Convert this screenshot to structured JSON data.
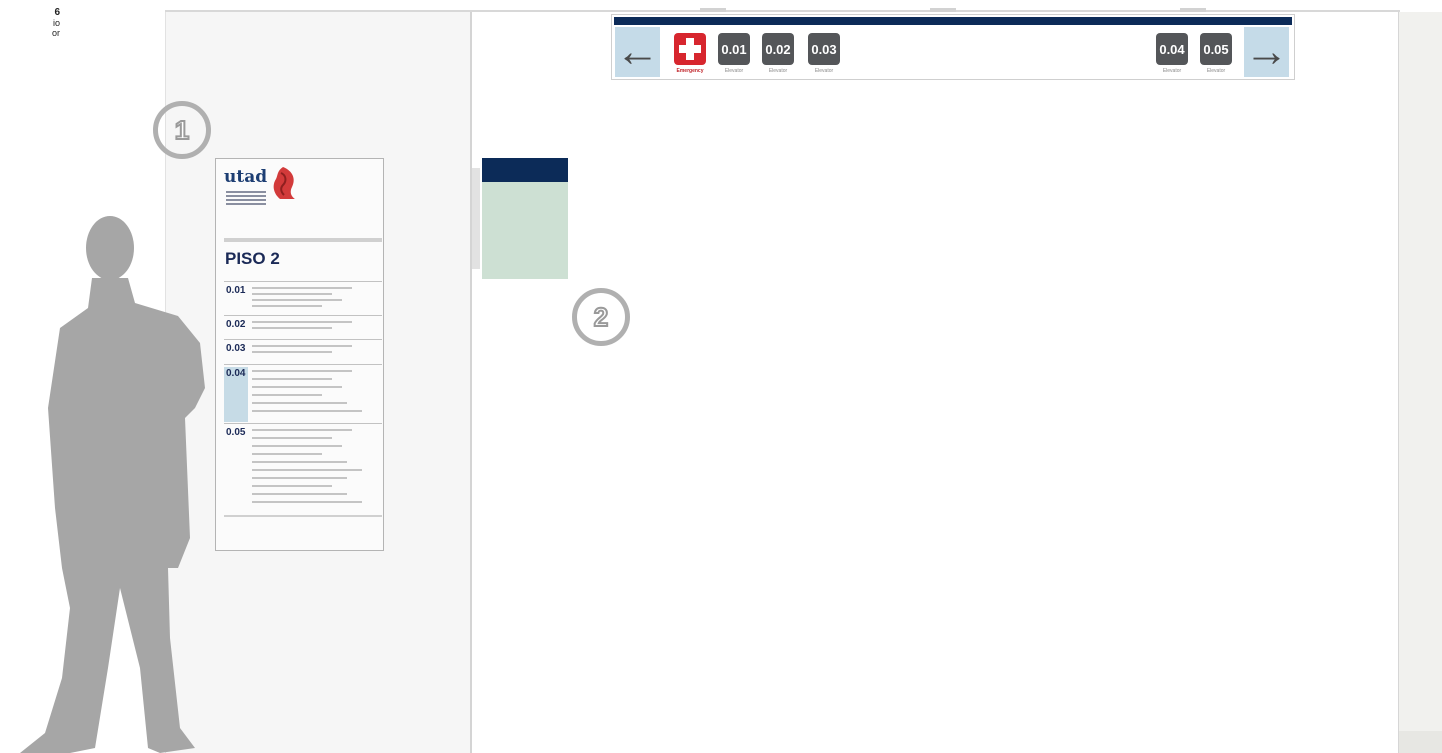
{
  "corner_text": {
    "line1": "6",
    "line2": "io",
    "line3": "or"
  },
  "badges": {
    "one": "1",
    "two": "2"
  },
  "panel": {
    "logo": "utad",
    "floor_title": "PISO 2",
    "rows": [
      {
        "number": "0.01",
        "highlighted": false
      },
      {
        "number": "0.02",
        "highlighted": false
      },
      {
        "number": "0.03",
        "highlighted": false
      },
      {
        "number": "0.04",
        "highlighted": true
      },
      {
        "number": "0.05",
        "highlighted": false
      }
    ]
  },
  "sign_bar": {
    "left_arrow": "←",
    "right_arrow": "→",
    "emergency_label": "Emergency",
    "rooms": [
      {
        "label": "0.01",
        "sub": "Elevator"
      },
      {
        "label": "0.02",
        "sub": "Elevator"
      },
      {
        "label": "0.03",
        "sub": "Elevator"
      },
      {
        "label": "0.04",
        "sub": "Elevator"
      },
      {
        "label": "0.05",
        "sub": "Elevator"
      }
    ]
  },
  "colors": {
    "navy": "#0c2b58",
    "emergency_red": "#d7262e",
    "light_blue": "#c5dbe8",
    "mint": "#cde0d3",
    "silhouette": "#a6a6a6"
  },
  "icons": {
    "emergency": "medical-cross-icon",
    "left": "arrow-left-icon",
    "right": "arrow-right-icon",
    "logo": "utad-crest-icon"
  }
}
